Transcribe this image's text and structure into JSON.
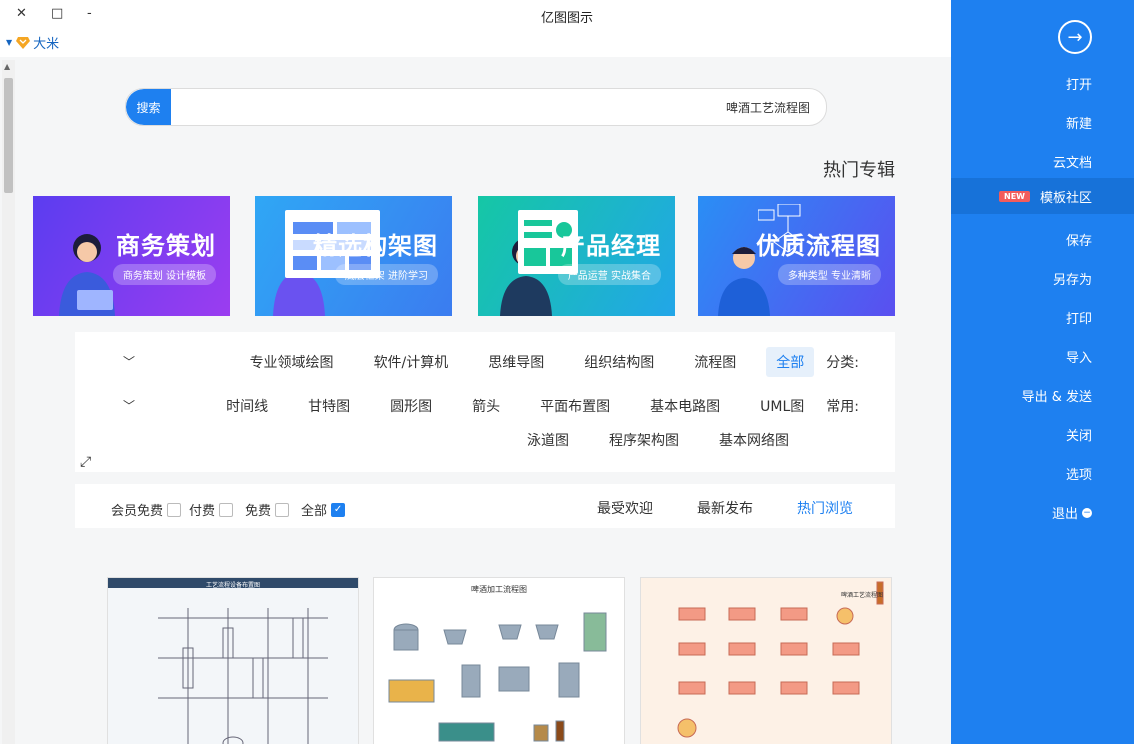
{
  "window": {
    "title": "亿图图示",
    "close": "✕",
    "maximize": "□",
    "minimize": "-"
  },
  "user": {
    "name": "大米"
  },
  "search": {
    "button": "搜索",
    "value": "啤酒工艺流程图"
  },
  "section_title": "热门专辑",
  "banners": [
    {
      "title": "商务策划",
      "sub": "商务策划 设计模板"
    },
    {
      "title": "精选构架图",
      "sub": "底层框架 进阶学习"
    },
    {
      "title": "产品经理",
      "sub": "产品运营 实战集合"
    },
    {
      "title": "优质流程图",
      "sub": "多种类型 专业清晰"
    }
  ],
  "filters": {
    "category_label": "分类:",
    "categories": [
      "全部",
      "流程图",
      "组织结构图",
      "思维导图",
      "软件/计算机",
      "专业领域绘图"
    ],
    "common_label": "常用:",
    "common": [
      "UML图",
      "基本电路图",
      "平面布置图",
      "箭头",
      "圆形图",
      "甘特图",
      "时间线"
    ],
    "common_row2": [
      "基本网络图",
      "程序架构图",
      "泳道图"
    ]
  },
  "sort": {
    "tabs": [
      "热门浏览",
      "最新发布",
      "最受欢迎"
    ]
  },
  "price_filters": [
    "全部",
    "免费",
    "付费",
    "会员免费"
  ],
  "cards": [
    {
      "title": "工艺流程设备布置图"
    },
    {
      "title": "啤酒加工流程图"
    },
    {
      "title": "啤酒工艺流程图"
    }
  ],
  "sidebar": {
    "items": [
      "打开",
      "新建",
      "云文档",
      "模板社区",
      "保存",
      "另存为",
      "打印",
      "导入",
      "导出 & 发送",
      "关闭",
      "选项",
      "退出"
    ],
    "new_badge": "NEW"
  },
  "colors": {
    "accent": "#1e80f0",
    "sidebar": "#1e80f0"
  }
}
